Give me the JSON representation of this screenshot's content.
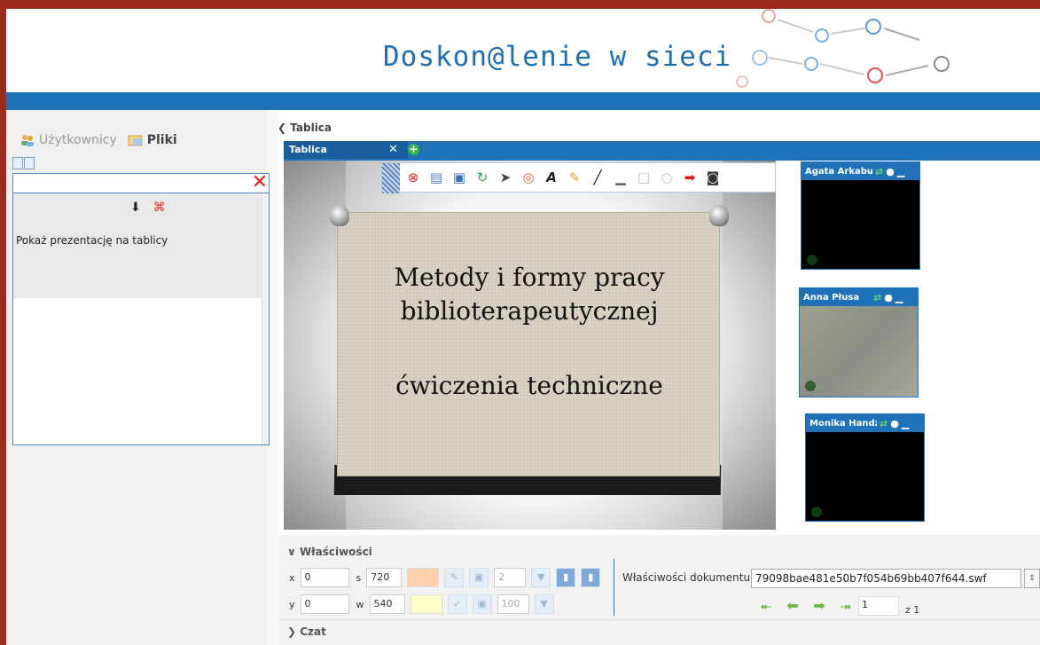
{
  "header": {
    "title": "Doskon@lenie w sieci"
  },
  "left_panel": {
    "tabs": [
      {
        "label": "Użytkownicy",
        "active": false
      },
      {
        "label": "Pliki",
        "active": true
      }
    ],
    "show_presentation_label": "Pokaż prezentację na tablicy"
  },
  "main": {
    "title": "Tablica",
    "board_tab": "Tablica",
    "slide": {
      "title_line1": "Metody i formy pracy",
      "title_line2": "biblioterapeutycznej",
      "subtitle": "ćwiczenia techniczne"
    }
  },
  "videos": [
    {
      "name": "Agata Arkabus"
    },
    {
      "name": "Anna Płusa"
    },
    {
      "name": "Monika Handz"
    }
  ],
  "properties": {
    "title": "Właściwości",
    "x_label": "x",
    "x_value": "0",
    "y_label": "y",
    "y_value": "0",
    "s_label": "s",
    "s_value": "720",
    "w_label": "w",
    "w_value": "540",
    "line_width": "2",
    "opacity": "100",
    "document_label": "Właściwości dokumentu",
    "document_value": "79098bae481e50b7f054b69bb407f644.swf",
    "page_current": "1",
    "page_of": "z 1"
  },
  "chat": {
    "title": "Czat"
  },
  "colors": {
    "frame": "#9b2a1f",
    "accent_blue": "#1f72b8",
    "stroke_swatch": "#ffd0b0",
    "fill_swatch": "#ffffc8",
    "nav_green": "#67b842"
  }
}
